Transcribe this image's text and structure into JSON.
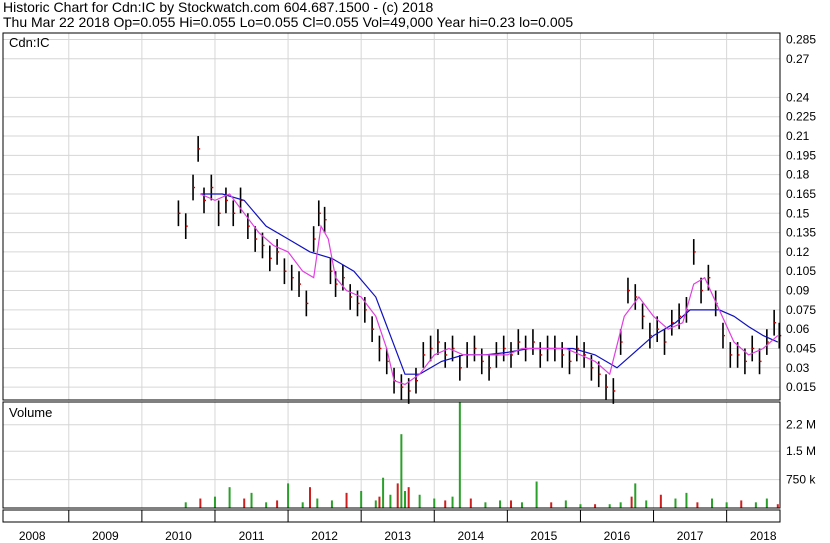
{
  "header": {
    "line1": "Historic Chart for Cdn:IC by Stockwatch.com 604.687.1500 - (c) 2018",
    "line2": "Thu Mar 22 2018   Op=0.055   Hi=0.055   Lo=0.055   Cl=0.055   Vol=49,000   Year hi=0.23   lo=0.005"
  },
  "chart_data": {
    "type": "bar",
    "symbol_label": "Cdn:IC",
    "volume_label": "Volume",
    "price_axis": {
      "ticks": [
        0.015,
        0.03,
        0.045,
        0.06,
        0.075,
        0.09,
        0.105,
        0.12,
        0.135,
        0.15,
        0.165,
        0.18,
        0.195,
        0.21,
        0.225,
        0.24,
        0.27,
        0.285
      ],
      "range": [
        0.005,
        0.29
      ]
    },
    "volume_axis": {
      "ticks": [
        {
          "value": 750000,
          "label": "750 k"
        },
        {
          "value": 1500000,
          "label": "1.5 M"
        },
        {
          "value": 2200000,
          "label": "2.2 M"
        }
      ],
      "range": [
        0,
        2800000
      ]
    },
    "x_axis": {
      "labels": [
        "2008",
        "2009",
        "2010",
        "2011",
        "2012",
        "2013",
        "2014",
        "2015",
        "2016",
        "2017",
        "2018"
      ],
      "range": [
        2007.6,
        2018.23
      ]
    },
    "series": [
      {
        "kind": "close",
        "color": "#000000",
        "x": [
          2010.0,
          2010.1,
          2010.2,
          2010.27,
          2010.35,
          2010.45,
          2010.55,
          2010.65,
          2010.75,
          2010.85,
          2010.95,
          2011.05,
          2011.15,
          2011.25,
          2011.35,
          2011.45,
          2011.55,
          2011.65,
          2011.75,
          2011.85,
          2011.92,
          2012.0,
          2012.08,
          2012.15,
          2012.25,
          2012.35,
          2012.45,
          2012.55,
          2012.65,
          2012.75,
          2012.85,
          2012.95,
          2013.05,
          2013.15,
          2013.25,
          2013.35,
          2013.45,
          2013.55,
          2013.65,
          2013.75,
          2013.85,
          2013.95,
          2014.05,
          2014.15,
          2014.25,
          2014.35,
          2014.45,
          2014.55,
          2014.65,
          2014.75,
          2014.85,
          2014.95,
          2015.05,
          2015.15,
          2015.25,
          2015.35,
          2015.45,
          2015.55,
          2015.65,
          2015.75,
          2015.85,
          2015.95,
          2016.05,
          2016.15,
          2016.25,
          2016.35,
          2016.45,
          2016.55,
          2016.65,
          2016.75,
          2016.85,
          2016.95,
          2017.05,
          2017.15,
          2017.25,
          2017.35,
          2017.45,
          2017.55,
          2017.65,
          2017.75,
          2017.85,
          2017.95,
          2018.05,
          2018.15,
          2018.22
        ],
        "y": [
          0.15,
          0.14,
          0.17,
          0.2,
          0.16,
          0.17,
          0.15,
          0.16,
          0.15,
          0.16,
          0.14,
          0.13,
          0.125,
          0.115,
          0.12,
          0.105,
          0.1,
          0.095,
          0.08,
          0.13,
          0.15,
          0.145,
          0.105,
          0.095,
          0.1,
          0.085,
          0.08,
          0.075,
          0.06,
          0.045,
          0.035,
          0.02,
          0.015,
          0.012,
          0.02,
          0.04,
          0.045,
          0.05,
          0.04,
          0.045,
          0.03,
          0.04,
          0.045,
          0.035,
          0.03,
          0.04,
          0.045,
          0.04,
          0.05,
          0.045,
          0.05,
          0.04,
          0.045,
          0.045,
          0.04,
          0.035,
          0.045,
          0.04,
          0.03,
          0.025,
          0.015,
          0.012,
          0.05,
          0.09,
          0.085,
          0.07,
          0.055,
          0.06,
          0.05,
          0.065,
          0.07,
          0.075,
          0.12,
          0.09,
          0.1,
          0.08,
          0.055,
          0.04,
          0.04,
          0.035,
          0.045,
          0.035,
          0.05,
          0.065,
          0.055
        ]
      },
      {
        "kind": "moving-average-short",
        "color": "#e040e0",
        "x": [
          2010.3,
          2010.5,
          2010.7,
          2010.9,
          2011.1,
          2011.3,
          2011.5,
          2011.7,
          2011.85,
          2011.95,
          2012.05,
          2012.15,
          2012.3,
          2012.5,
          2012.7,
          2012.85,
          2012.95,
          2013.1,
          2013.3,
          2013.5,
          2013.7,
          2013.9,
          2014.1,
          2014.3,
          2014.5,
          2014.7,
          2014.9,
          2015.1,
          2015.3,
          2015.5,
          2015.7,
          2015.9,
          2016.1,
          2016.3,
          2016.5,
          2016.7,
          2016.9,
          2017.05,
          2017.2,
          2017.4,
          2017.6,
          2017.8,
          2018.0,
          2018.2
        ],
        "y": [
          0.165,
          0.16,
          0.165,
          0.15,
          0.135,
          0.125,
          0.12,
          0.105,
          0.1,
          0.14,
          0.13,
          0.1,
          0.09,
          0.085,
          0.07,
          0.045,
          0.02,
          0.017,
          0.025,
          0.04,
          0.045,
          0.04,
          0.04,
          0.04,
          0.04,
          0.045,
          0.045,
          0.045,
          0.045,
          0.04,
          0.035,
          0.025,
          0.07,
          0.085,
          0.07,
          0.06,
          0.065,
          0.095,
          0.1,
          0.075,
          0.05,
          0.04,
          0.045,
          0.055
        ]
      },
      {
        "kind": "moving-average-long",
        "color": "#1010c0",
        "x": [
          2010.3,
          2010.6,
          2010.9,
          2011.2,
          2011.5,
          2011.8,
          2012.1,
          2012.4,
          2012.7,
          2012.9,
          2013.1,
          2013.3,
          2013.6,
          2013.9,
          2014.2,
          2014.5,
          2014.8,
          2015.1,
          2015.4,
          2015.7,
          2016.0,
          2016.2,
          2016.5,
          2016.8,
          2017.0,
          2017.2,
          2017.4,
          2017.6,
          2017.8,
          2018.0,
          2018.2
        ],
        "y": [
          0.165,
          0.165,
          0.16,
          0.14,
          0.13,
          0.12,
          0.115,
          0.105,
          0.085,
          0.055,
          0.025,
          0.025,
          0.035,
          0.04,
          0.04,
          0.042,
          0.045,
          0.045,
          0.045,
          0.04,
          0.03,
          0.04,
          0.055,
          0.065,
          0.075,
          0.075,
          0.075,
          0.07,
          0.062,
          0.055,
          0.05
        ]
      },
      {
        "kind": "volume",
        "color": "#2aa02a",
        "x": [
          2010.1,
          2010.3,
          2010.5,
          2010.7,
          2010.9,
          2011.0,
          2011.2,
          2011.35,
          2011.5,
          2011.7,
          2011.8,
          2011.9,
          2012.1,
          2012.3,
          2012.5,
          2012.7,
          2012.75,
          2012.8,
          2012.9,
          2013.0,
          2013.05,
          2013.1,
          2013.15,
          2013.3,
          2013.5,
          2013.65,
          2013.75,
          2013.85,
          2014.0,
          2014.2,
          2014.4,
          2014.55,
          2014.7,
          2014.9,
          2015.1,
          2015.3,
          2015.5,
          2015.7,
          2015.9,
          2016.05,
          2016.2,
          2016.25,
          2016.4,
          2016.6,
          2016.8,
          2016.95,
          2017.1,
          2017.3,
          2017.5,
          2017.7,
          2017.9,
          2018.05,
          2018.2
        ],
        "y": [
          150000,
          250000,
          300000,
          550000,
          250000,
          400000,
          150000,
          200000,
          650000,
          150000,
          550000,
          250000,
          200000,
          400000,
          450000,
          200000,
          300000,
          800000,
          350000,
          650000,
          1950000,
          450000,
          550000,
          350000,
          250000,
          200000,
          300000,
          2800000,
          250000,
          150000,
          200000,
          200000,
          150000,
          700000,
          150000,
          200000,
          100000,
          100000,
          100000,
          150000,
          300000,
          650000,
          200000,
          350000,
          250000,
          400000,
          150000,
          250000,
          150000,
          200000,
          150000,
          250000,
          100000
        ]
      }
    ]
  }
}
